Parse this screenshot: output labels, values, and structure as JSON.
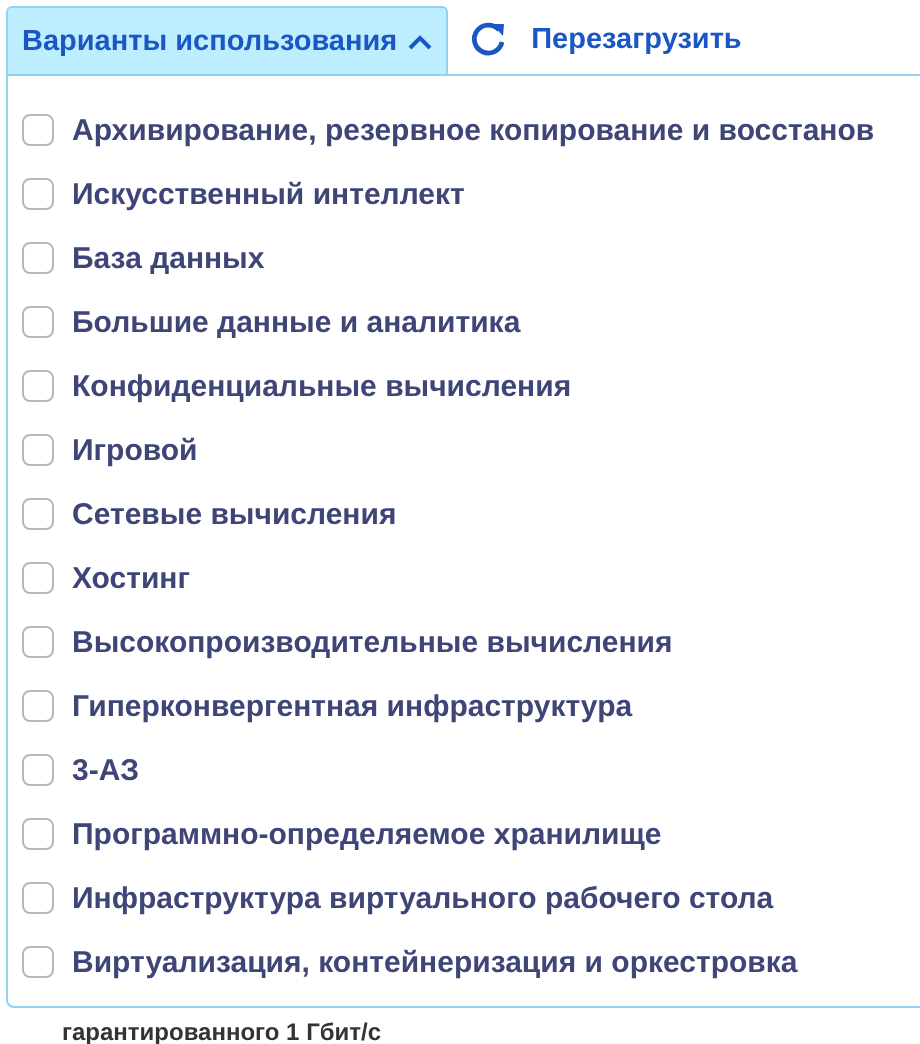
{
  "toolbar": {
    "filter_tab": {
      "label": "Варианты использования",
      "expanded": true
    },
    "reload_button": {
      "label": "Перезагрузить"
    }
  },
  "options": [
    {
      "label": "Архивирование, резервное копирование и восстанов",
      "checked": false
    },
    {
      "label": "Искусственный интеллект",
      "checked": false
    },
    {
      "label": "База данных",
      "checked": false
    },
    {
      "label": "Большие данные и аналитика",
      "checked": false
    },
    {
      "label": "Конфиденциальные вычисления",
      "checked": false
    },
    {
      "label": "Игровой",
      "checked": false
    },
    {
      "label": "Сетевые вычисления",
      "checked": false
    },
    {
      "label": "Хостинг",
      "checked": false
    },
    {
      "label": "Высокопроизводительные вычисления",
      "checked": false
    },
    {
      "label": "Гиперконвергентная инфраструктура",
      "checked": false
    },
    {
      "label": "3-АЗ",
      "checked": false
    },
    {
      "label": "Программно-определяемое хранилище",
      "checked": false
    },
    {
      "label": "Инфраструктура виртуального рабочего стола",
      "checked": false
    },
    {
      "label": "Виртуализация, контейнеризация и оркестровка",
      "checked": false
    }
  ],
  "footer_text": "гарантированного 1 Гбит/с"
}
